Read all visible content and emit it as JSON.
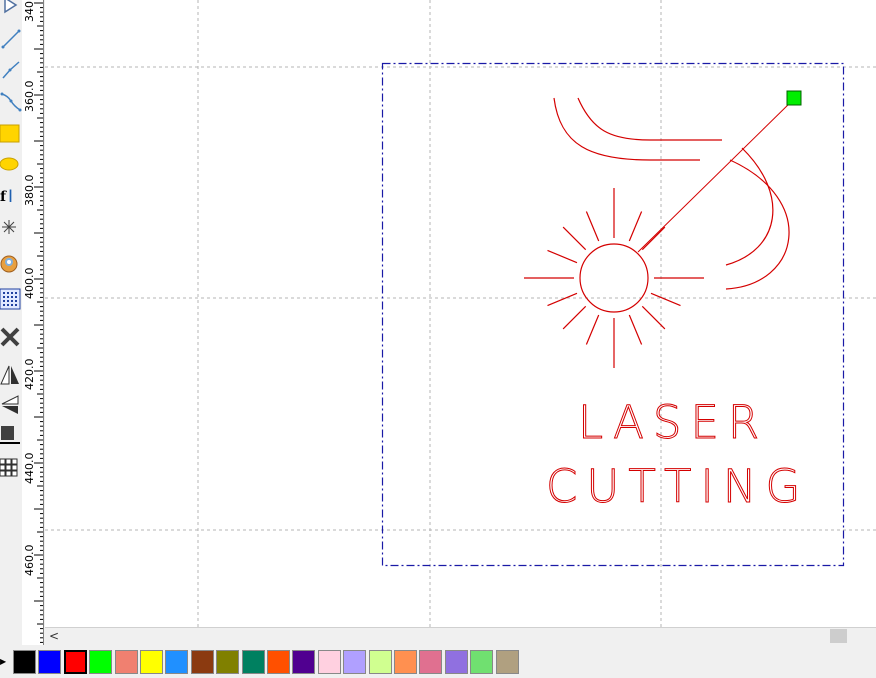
{
  "ruler": {
    "labels": [
      "340",
      "360.0",
      "380.0",
      "400.0",
      "420.0",
      "440.0",
      "460.0"
    ]
  },
  "tools": [
    {
      "name": "select-pointer-icon"
    },
    {
      "name": "line-tool-icon"
    },
    {
      "name": "polyline-tool-icon"
    },
    {
      "name": "bezier-tool-icon"
    },
    {
      "name": "rectangle-tool-icon"
    },
    {
      "name": "ellipse-tool-icon"
    },
    {
      "name": "text-tool-icon"
    },
    {
      "name": "star-tool-icon"
    },
    {
      "name": "image-tool-icon"
    },
    {
      "name": "raster-grid-icon"
    },
    {
      "name": "delete-icon"
    },
    {
      "name": "mirror-horizontal-icon"
    },
    {
      "name": "mirror-vertical-icon"
    },
    {
      "name": "align-icon"
    },
    {
      "name": "array-grid-icon"
    }
  ],
  "design": {
    "text_line1": "LASER",
    "text_line2": "CUTTING",
    "stroke_color": "#d40000",
    "bbox_color": "#1a1aa6",
    "handle_color": "#00ee00"
  },
  "scrollbar": {
    "left_arrow": "<"
  },
  "palette": {
    "arrow": "▶",
    "selected_index": 2,
    "colors": [
      "#000000",
      "#0000ff",
      "#ff0000",
      "#00ff00",
      "#f08070",
      "#ffff00",
      "#2090ff",
      "#8b3a10",
      "#808000",
      "#008060",
      "#ff5000",
      "#500090",
      "#ffd0e0",
      "#b0a0ff",
      "#d0ff90",
      "#ff9050",
      "#e07090",
      "#9070e0",
      "#70e070",
      "#b0a080"
    ]
  }
}
